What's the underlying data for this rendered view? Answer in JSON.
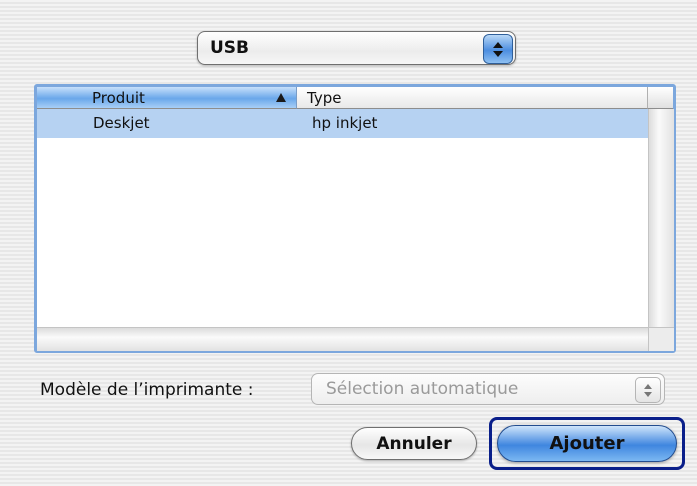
{
  "connection": {
    "selected": "USB"
  },
  "table": {
    "columns": [
      "Produit",
      "Type"
    ],
    "rows": [
      {
        "product": "Deskjet",
        "type": "hp inkjet"
      }
    ]
  },
  "model": {
    "label": "Modèle de l’imprimante :",
    "selected": "Sélection automatique"
  },
  "buttons": {
    "cancel": "Annuler",
    "add": "Ajouter"
  }
}
